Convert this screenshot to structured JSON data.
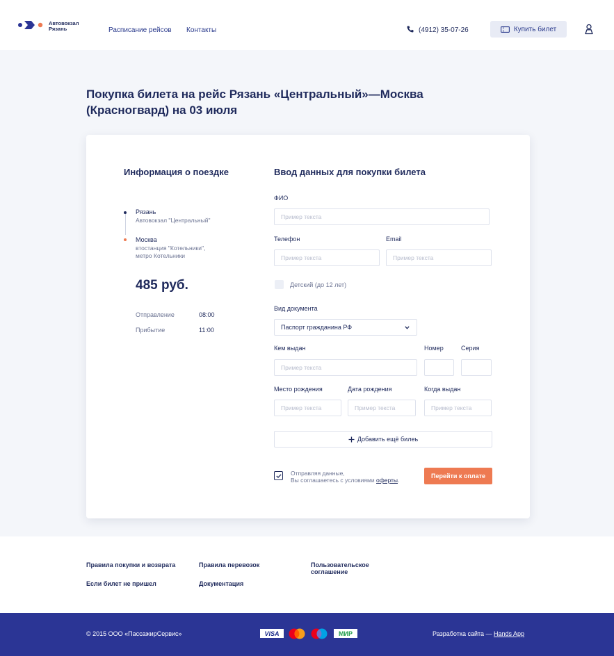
{
  "header": {
    "logo_line1": "Автовокзал",
    "logo_line2": "Рязань",
    "nav": [
      "Расписание рейсов",
      "Контакты"
    ],
    "phone": "(4912) 35-07-26",
    "buy_label": "Купить билет"
  },
  "page_title": "Покупка билета на рейс Рязань «Центральный»—Москва (Красногвард) на 03 июля",
  "trip": {
    "title": "Информация о поездке",
    "from_name": "Рязань",
    "from_sub": "Автовокзал \"Центральный\"",
    "to_name": "Москва",
    "to_sub_line1": "втостанция \"Котельники\",",
    "to_sub_line2": "метро Котельники",
    "price": "485 руб.",
    "departure_label": "Отправление",
    "departure_time": "08:00",
    "arrival_label": "Прибытие",
    "arrival_time": "11:00"
  },
  "form": {
    "title": "Ввод данных для покупки билета",
    "fio_label": "ФИО",
    "phone_label": "Телефон",
    "email_label": "Email",
    "placeholder": "Пример текста",
    "child_label": "Детский (до 12 лет)",
    "doc_type_label": "Вид документа",
    "doc_type_value": "Паспорт гражданина РФ",
    "issued_by_label": "Кем выдан",
    "number_label": "Номер",
    "series_label": "Серия",
    "birthplace_label": "Место рождения",
    "birthdate_label": "Дата рождения",
    "issued_when_label": "Когда выдан",
    "add_ticket": "Добавить ещё билеь",
    "agree_line1": "Отправляя данные,",
    "agree_line2": "Вы соглашаетесь с условиями",
    "agree_link": "оферты",
    "agree_dot": ".",
    "pay_label": "Перейти к оплате"
  },
  "footer": {
    "links": [
      "Правила покупки и возврата",
      "Правила перевозок",
      "Пользовательское",
      "соглашение",
      "Если билет не пришел",
      "Документация"
    ],
    "copyright": "© 2015 ООО «ПассажирСервис»",
    "visa": "VISA",
    "mir": "МИР",
    "dev_prefix": "Разработка сайта — ",
    "dev_link": "Hands App"
  },
  "colors": {
    "navy": "#1f2a5c",
    "accent": "#ee7a52",
    "footer_bg": "#2b3595"
  }
}
